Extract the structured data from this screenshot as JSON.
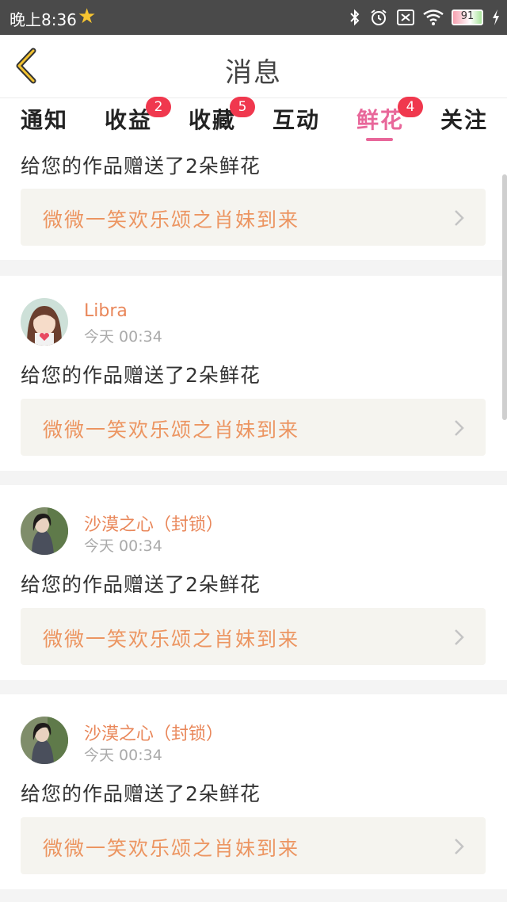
{
  "status_bar": {
    "time": "晚上8:36",
    "battery": "91"
  },
  "header": {
    "title": "消息"
  },
  "tabs": [
    {
      "label": "通知",
      "badge": ""
    },
    {
      "label": "收益",
      "badge": "2"
    },
    {
      "label": "收藏",
      "badge": "5"
    },
    {
      "label": "互动",
      "badge": ""
    },
    {
      "label": "鲜花",
      "badge": "4",
      "active": true
    },
    {
      "label": "关注",
      "badge": ""
    }
  ],
  "feed": {
    "partial_item": {
      "message": "给您的作品赠送了2朵鲜花",
      "work_title": "微微一笑欢乐颂之肖妹到来"
    },
    "items": [
      {
        "username": "Libra",
        "time": "今天 00:34",
        "message": "给您的作品赠送了2朵鲜花",
        "work_title": "微微一笑欢乐颂之肖妹到来"
      },
      {
        "username": "沙漠之心（封锁）",
        "time": "今天 00:34",
        "message": "给您的作品赠送了2朵鲜花",
        "work_title": "微微一笑欢乐颂之肖妹到来"
      },
      {
        "username": "沙漠之心（封锁）",
        "time": "今天 00:34",
        "message": "给您的作品赠送了2朵鲜花",
        "work_title": "微微一笑欢乐颂之肖妹到来"
      }
    ]
  },
  "colors": {
    "accent": "#e8679a",
    "badge": "#f0384e",
    "username": "#e9875a",
    "work_title": "#ec9561"
  }
}
